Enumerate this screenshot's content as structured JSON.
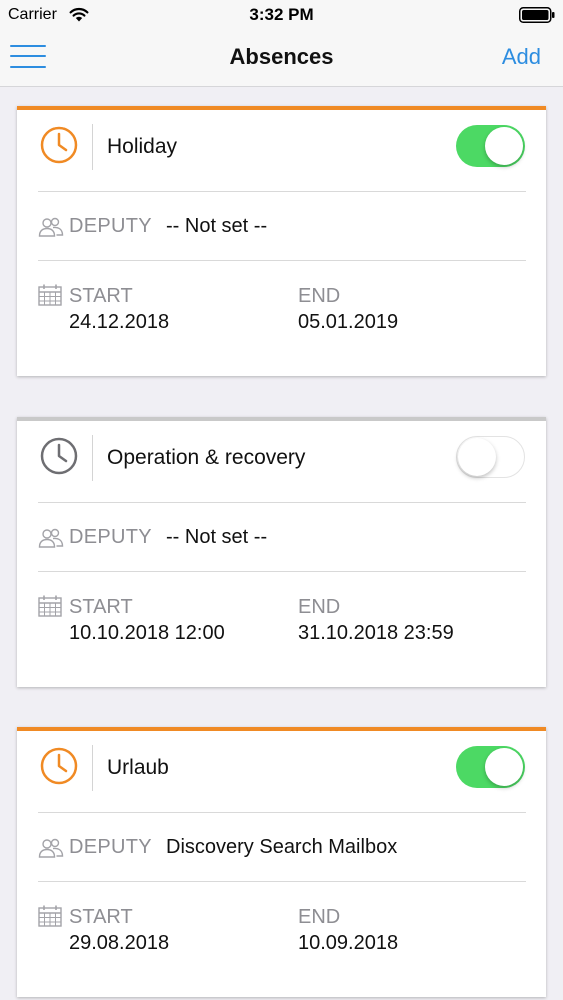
{
  "status_bar": {
    "carrier": "Carrier",
    "time": "3:32 PM"
  },
  "nav": {
    "title": "Absences",
    "add_label": "Add",
    "menu_icon": "hamburger-menu-icon"
  },
  "labels": {
    "deputy": "DEPUTY",
    "start": "START",
    "end": "END"
  },
  "colors": {
    "accent_active": "#f08a24",
    "accent_inactive": "#c9c9c9",
    "toggle_on": "#4cd964",
    "link": "#2d8de0"
  },
  "absences": [
    {
      "name": "Holiday",
      "enabled": true,
      "deputy": "-- Not set --",
      "start": "24.12.2018",
      "end": "05.01.2019"
    },
    {
      "name": "Operation & recovery",
      "enabled": false,
      "deputy": "-- Not set --",
      "start": "10.10.2018 12:00",
      "end": "31.10.2018 23:59"
    },
    {
      "name": "Urlaub",
      "enabled": true,
      "deputy": "Discovery Search Mailbox",
      "start": "29.08.2018",
      "end": "10.09.2018"
    }
  ]
}
